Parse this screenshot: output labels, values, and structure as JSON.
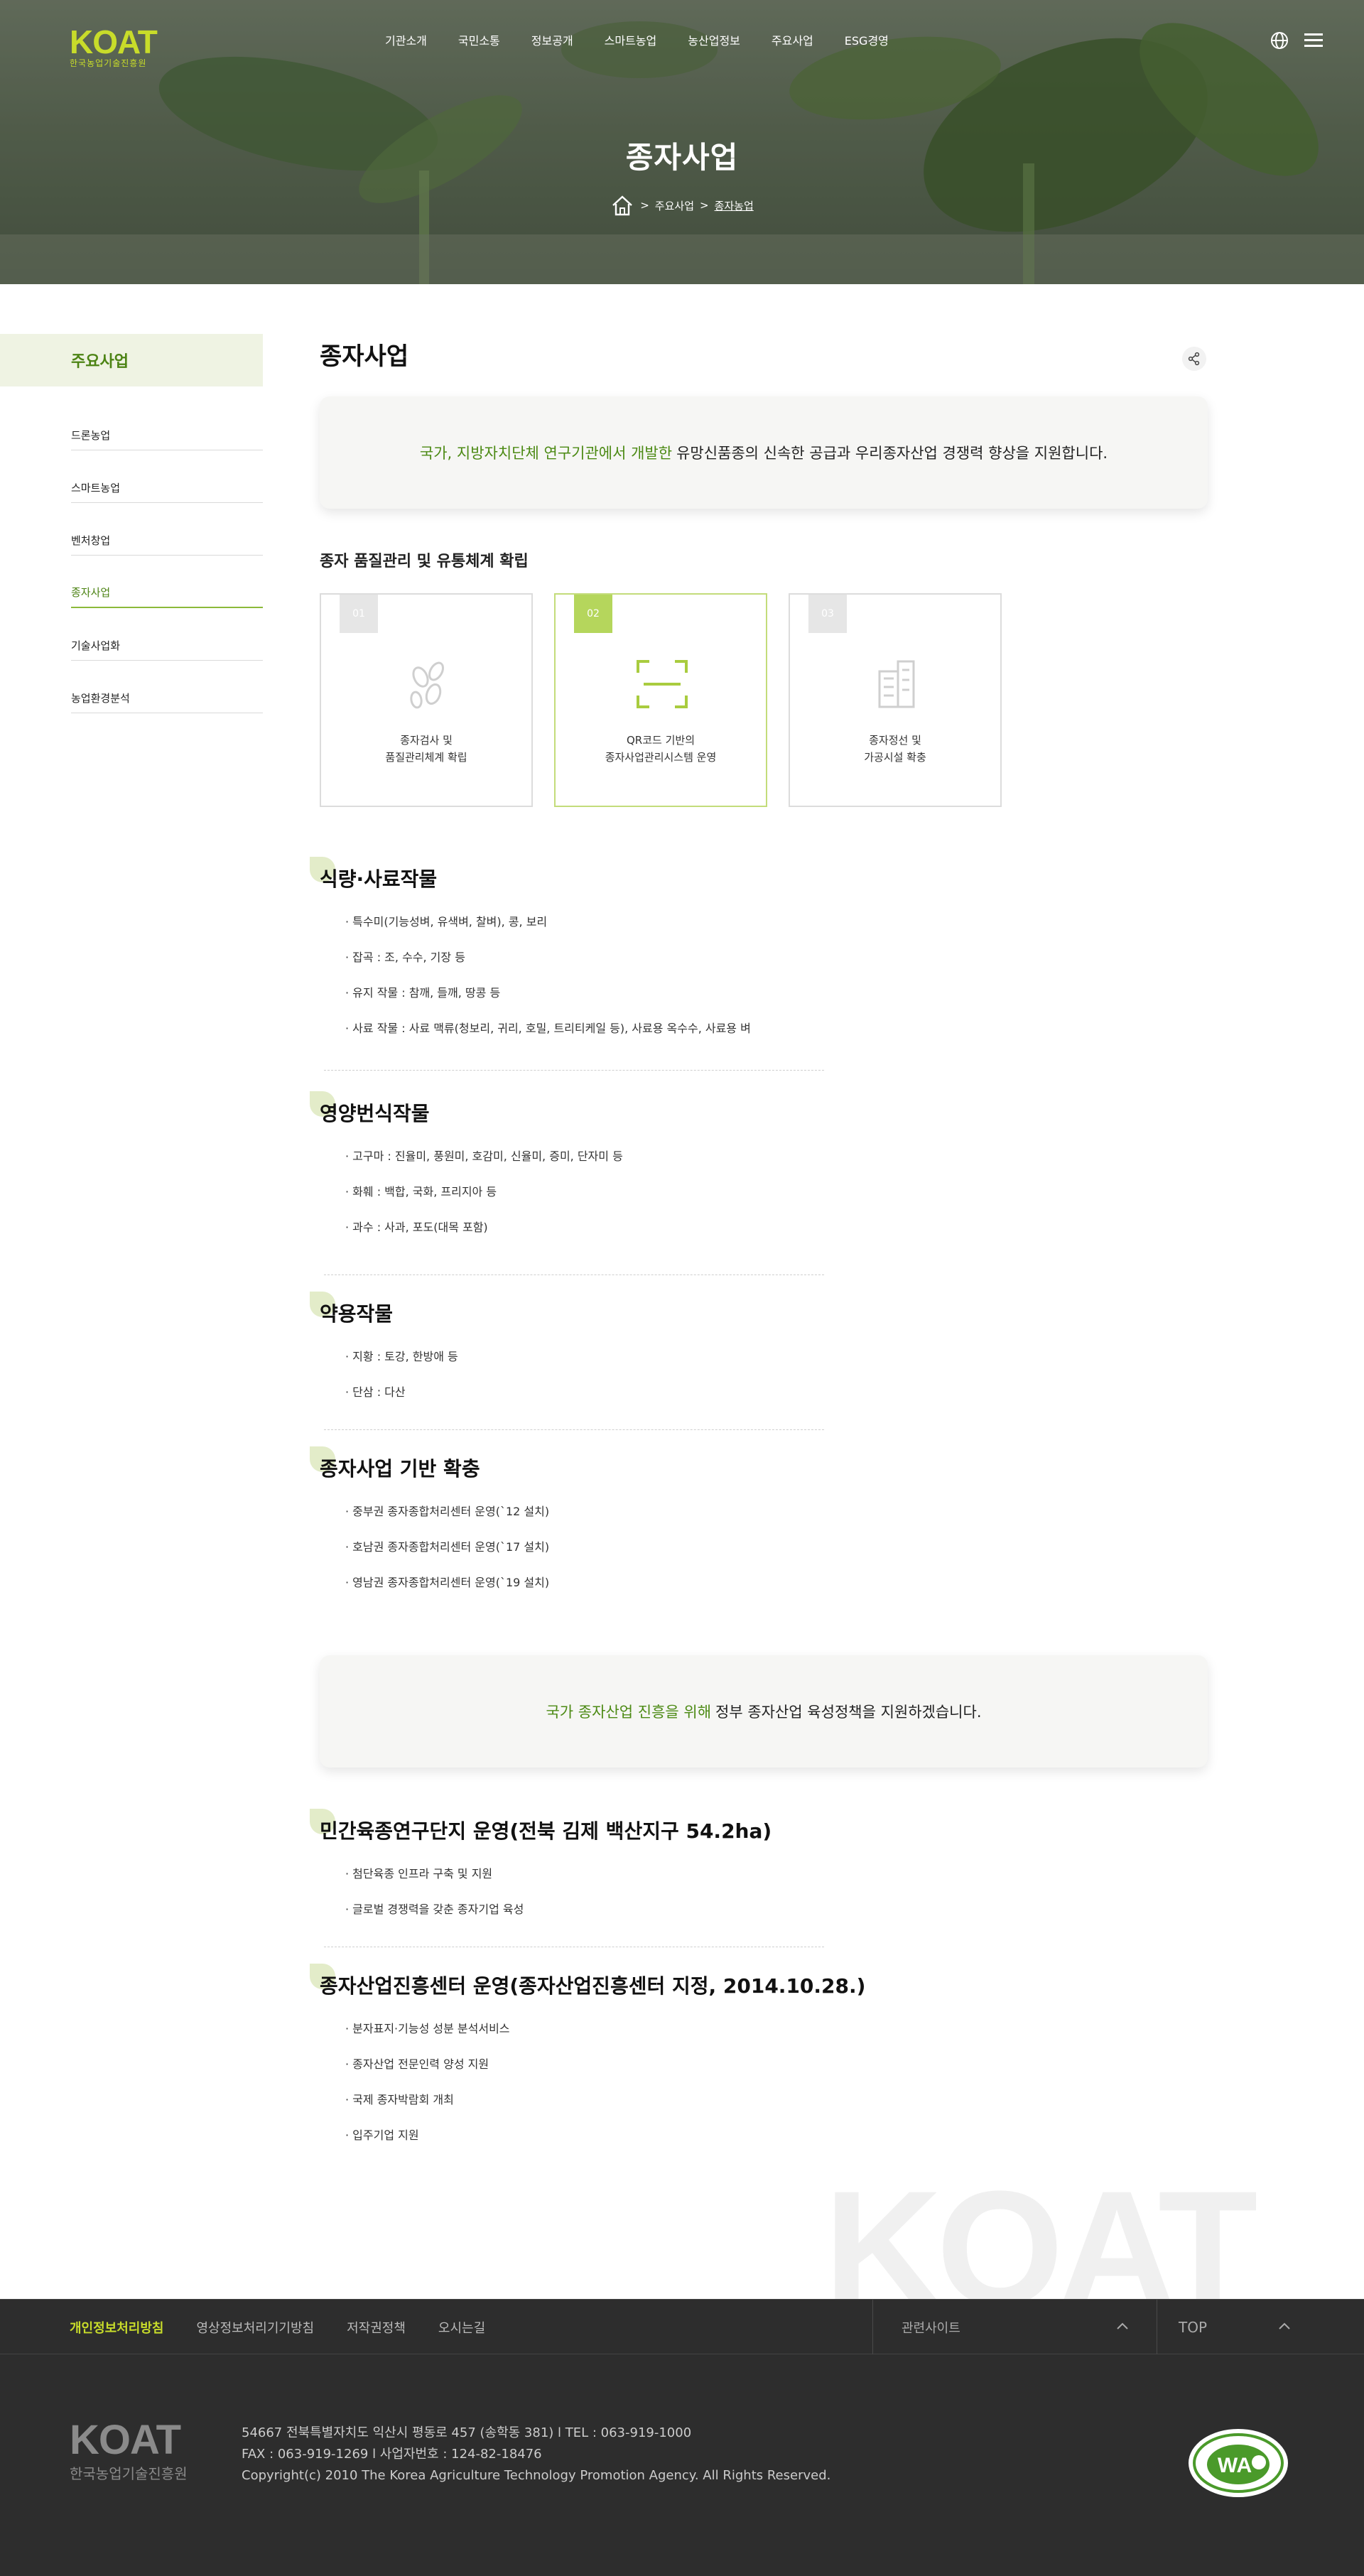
{
  "header": {
    "logo_text": "KOAT",
    "logo_subtext": "한국농업기술진흥원",
    "nav": [
      "기관소개",
      "국민소통",
      "정보공개",
      "스마트농업",
      "농산업정보",
      "주요사업",
      "ESG경영"
    ],
    "page_title": "종자사업",
    "breadcrumb": [
      "주요사업",
      "종자농업"
    ]
  },
  "sidebar": {
    "title": "주요사업",
    "items": [
      "드론농업",
      "스마트농업",
      "벤처창업",
      "종자사업",
      "기술사업화",
      "농업환경분석"
    ],
    "active_index": 3
  },
  "main": {
    "title": "종자사업",
    "intro": {
      "highlight": "국가, 지방자치단체 연구기관에서 개발한",
      "text": "유망신품종의 신속한 공급과 우리종자산업 경쟁력 향상을 지원합니다."
    },
    "quality_heading": "종자 품질관리 및 유통체계 확립",
    "cards": [
      {
        "num": "01",
        "line1": "종자검사 및",
        "line2": "품질관리체계 확립",
        "icon": "seeds-icon"
      },
      {
        "num": "02",
        "line1": "QR코드 기반의",
        "line2": "종자사업관리시스템 운영",
        "icon": "qr-scan-icon"
      },
      {
        "num": "03",
        "line1": "종자정선 및",
        "line2": "가공시설 확충",
        "icon": "building-icon"
      }
    ],
    "sections": [
      {
        "title": "식량·사료작물",
        "items": [
          "· 특수미(기능성벼, 유색벼, 찰벼), 콩, 보리",
          "· 잡곡 : 조, 수수, 기장 등",
          "· 유지 작물 : 참깨, 들깨, 땅콩 등",
          "· 사료 작물 : 사료 맥류(청보리, 귀리, 호밀, 트리티케일 등), 사료용 옥수수, 사료용 벼"
        ]
      },
      {
        "title": "영양번식작물",
        "items": [
          "· 고구마 : 진율미, 풍원미, 호감미, 신율미, 증미, 단자미 등",
          "· 화훼 : 백합, 국화, 프리지아 등",
          "· 과수 : 사과, 포도(대목 포함)"
        ]
      },
      {
        "title": "약용작물",
        "items": [
          "· 지황 : 토강, 한방애 등",
          "· 단삼 : 다산"
        ]
      },
      {
        "title": "종자사업 기반 확충",
        "items": [
          "· 중부권 종자종합처리센터 운영(`12 설치)",
          "· 호남권 종자종합처리센터 운영(`17 설치)",
          "· 영남권 종자종합처리센터 운영(`19 설치)"
        ]
      }
    ],
    "promo": {
      "highlight": "국가 종자산업 진흥을 위해",
      "text": "정부 종자산업 육성정책을 지원하겠습니다."
    },
    "sections2": [
      {
        "title": "민간육종연구단지 운영(전북 김제 백산지구 54.2ha)",
        "items": [
          "· 첨단육종 인프라 구축 및 지원",
          "· 글로벌 경쟁력을 갖춘 종자기업 육성"
        ]
      },
      {
        "title": "종자산업진흥센터 운영(종자산업진흥센터 지정, 2014.10.28.)",
        "items": [
          "· 분자표지·기능성 성분 분석서비스",
          "· 종자산업 전문인력 양성 지원",
          "· 국제 종자박람회 개최",
          "· 입주기업 지원"
        ]
      }
    ]
  },
  "footer": {
    "links": [
      "개인정보처리방침",
      "영상정보처리기기방침",
      "저작권정책",
      "오시는길"
    ],
    "related_sites": "관련사이트",
    "top": "TOP",
    "logo_text": "KOAT",
    "logo_subtext": "한국농업기술진흥원",
    "address": "54667 전북특별자치도 익산시 평동로 457 (송학동 381) l TEL : 063-919-1000",
    "fax": "FAX : 063-919-1269 l 사업자번호 : 124-82-18476",
    "copyright": "Copyright(c) 2010 The Korea Agriculture Technology Promotion Agency. All Rights Reserved.",
    "wa_badge": "WA"
  },
  "colors": {
    "accent": "#4c8a14",
    "highlight_green": "#b5d65c",
    "logo_yellow": "#c8dc2a",
    "footer_bg": "#2d2d2d"
  }
}
